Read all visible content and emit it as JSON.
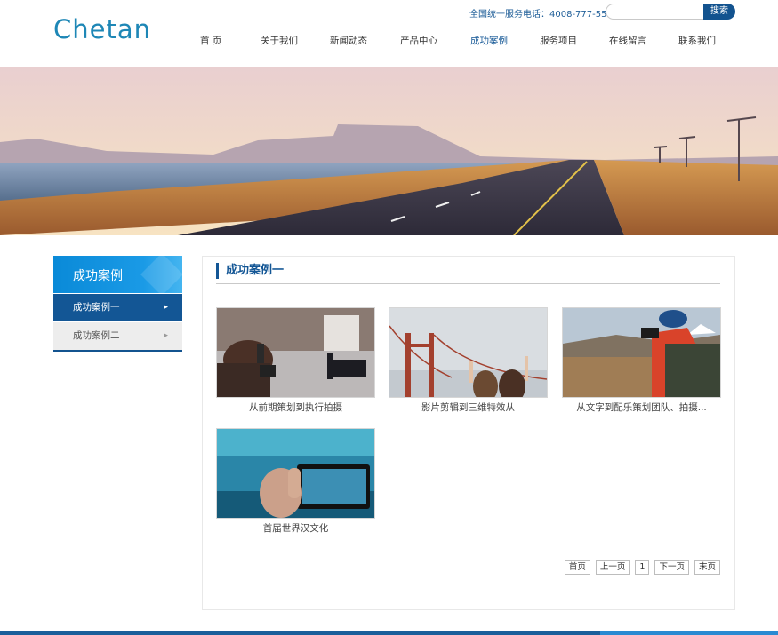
{
  "header": {
    "logo": "Chetan",
    "hotline": "全国统一服务电话：4008-777-555",
    "search_placeholder": "",
    "search_button": "搜索"
  },
  "nav": [
    "首 页",
    "关于我们",
    "新闻动态",
    "产品中心",
    "成功案例",
    "服务项目",
    "在线留言",
    "联系我们"
  ],
  "sidebar": {
    "title": "成功案例",
    "items": [
      {
        "label": "成功案例一",
        "active": true
      },
      {
        "label": "成功案例二",
        "active": false
      }
    ]
  },
  "main": {
    "title": "成功案例一",
    "cases": [
      {
        "caption": "从前期策划到执行拍摄"
      },
      {
        "caption": "影片剪辑到三维特效从"
      },
      {
        "caption": "从文字到配乐策划团队、拍摄..."
      },
      {
        "caption": "首届世界汉文化"
      }
    ],
    "pager": [
      "首页",
      "上一页",
      "1",
      "下一页",
      "末页"
    ]
  },
  "colors": {
    "brand": "#135695",
    "logo": "#1e87b6",
    "sidebar_head": "#0a8ad8"
  }
}
